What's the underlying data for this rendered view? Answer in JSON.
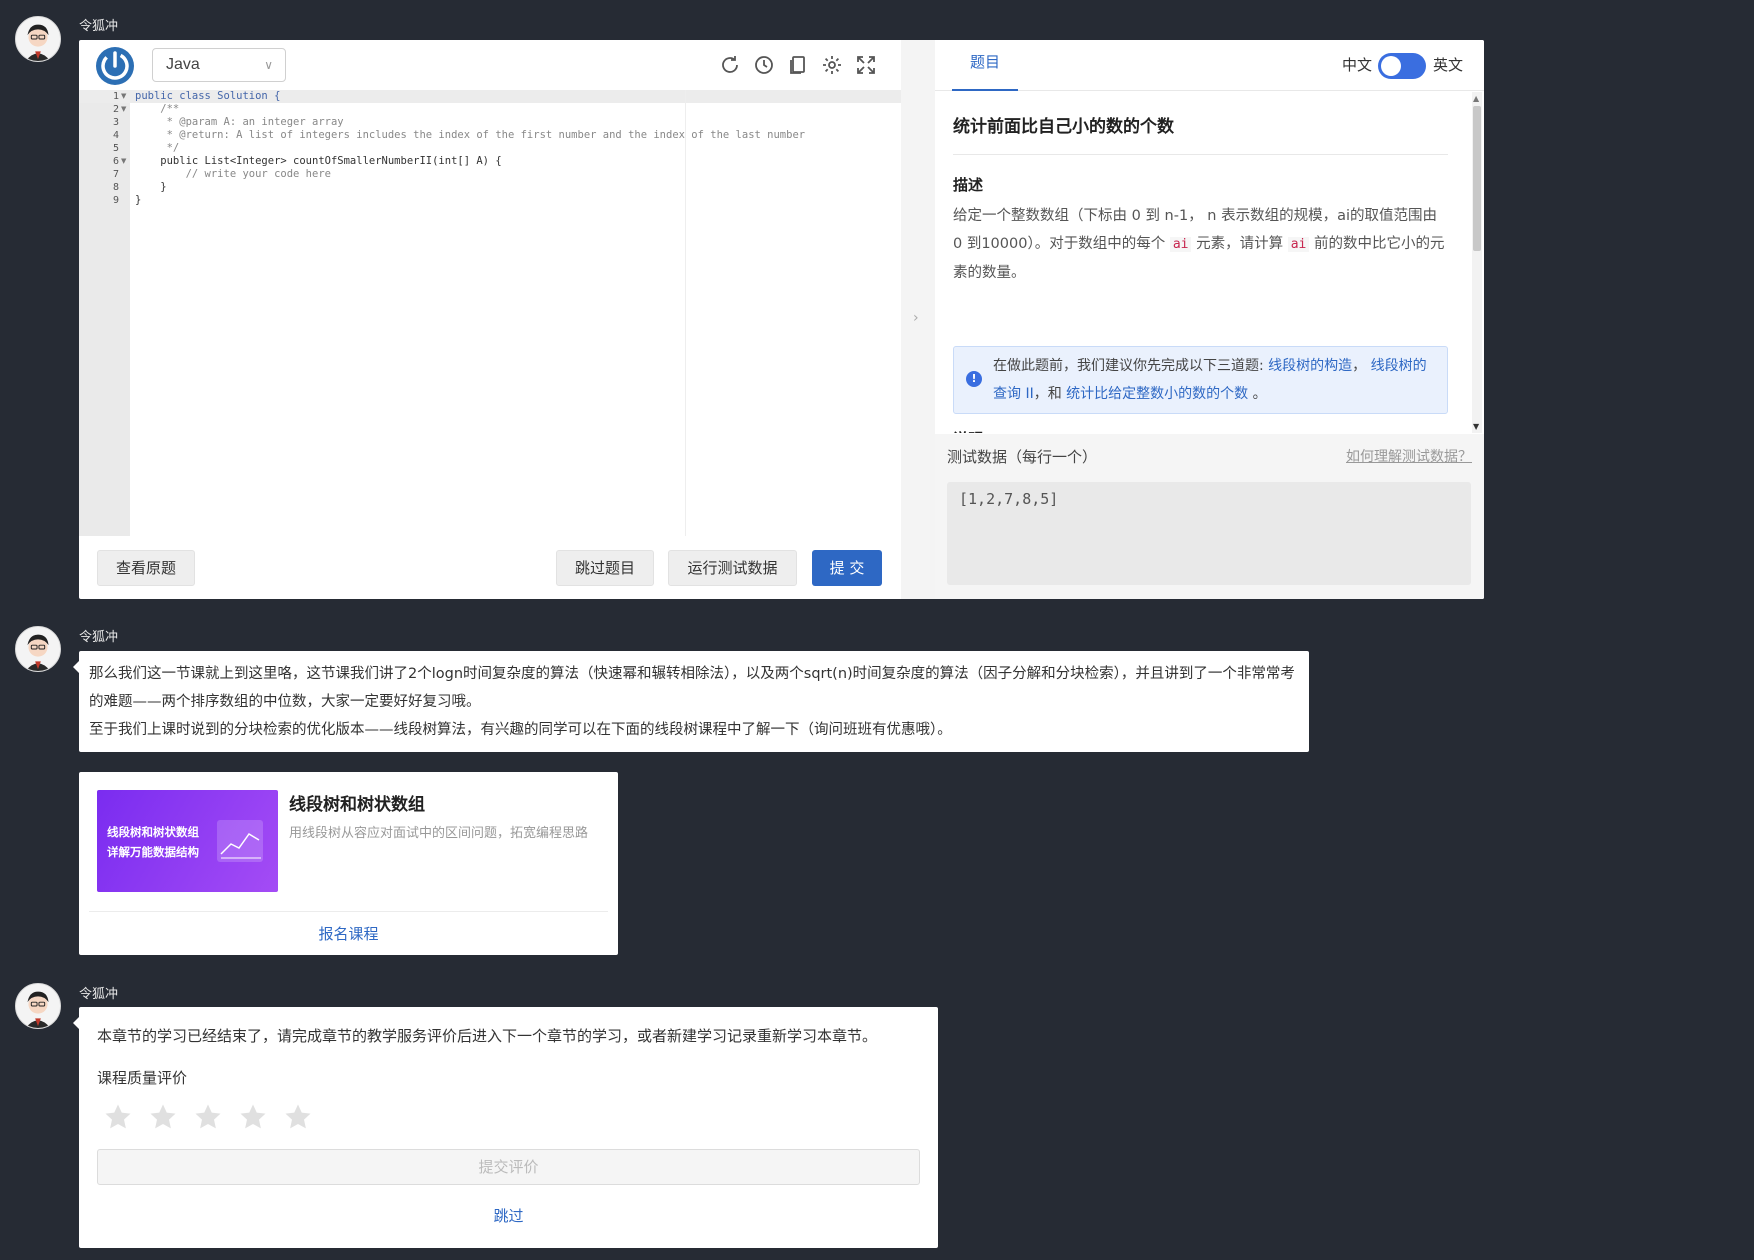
{
  "sender_name": "令狐冲",
  "ide": {
    "language": "Java",
    "code_lines": [
      "public class Solution {",
      "    /**",
      "     * @param A: an integer array",
      "     * @return: A list of integers includes the index of the first number and the index of the last number",
      "     */",
      "    public List<Integer> countOfSmallerNumberII(int[] A) {",
      "        // write your code here",
      "    }",
      "}"
    ],
    "line_numbers": [
      "1",
      "2",
      "3",
      "4",
      "5",
      "6",
      "7",
      "8",
      "9"
    ],
    "toolbar_icons": [
      "refresh-icon",
      "history-icon",
      "copy-icon",
      "settings-icon",
      "fullscreen-icon"
    ],
    "buttons": {
      "view_original": "查看原题",
      "skip_problem": "跳过题目",
      "run_test": "运行测试数据",
      "submit": "提 交"
    }
  },
  "problem": {
    "tab_label": "题目",
    "lang_zh": "中文",
    "lang_en": "英文",
    "title": "统计前面比自己小的数的个数",
    "desc_heading": "描述",
    "desc_part1": "给定一个整数数组（下标由 0 到 n-1， n 表示数组的规模，ai的取值范围由 0 到10000）。对于数组中的每个 ",
    "desc_code1": "ai",
    "desc_part2": " 元素，请计算 ",
    "desc_code2": "ai",
    "desc_part3": " 前的数中比它小的元素的数量。",
    "hint_prefix": "在做此题前，我们建议你先完成以下三道题: ",
    "hint_link1": "线段树的构造",
    "hint_sep1": "， ",
    "hint_link2": "线段树的查询 II",
    "hint_sep2": "，和 ",
    "hint_link3": "统计比给定整数小的数的个数",
    "hint_suffix": " 。",
    "explain_heading": "说明",
    "test_label": "测试数据（每行一个）",
    "test_help": "如何理解测试数据？",
    "test_value": "[1,2,7,8,5]"
  },
  "msg2": {
    "line1": "那么我们这一节课就上到这里咯，这节课我们讲了2个logn时间复杂度的算法（快速幂和辗转相除法），以及两个sqrt(n)时间复杂度的算法（因子分解和分块检索），并且讲到了一个非常常考的难题——两个排序数组的中位数，大家一定要好好复习哦。",
    "line2": "至于我们上课时说到的分块检索的优化版本——线段树算法，有兴趣的同学可以在下面的线段树课程中了解一下（询问班班有优惠哦）。"
  },
  "course": {
    "image_text_line1": "线段树和树状数组",
    "image_text_line2": "详解万能数据结构",
    "title": "线段树和树状数组",
    "description": "用线段树从容应对面试中的区间问题，拓宽编程思路",
    "enroll": "报名课程"
  },
  "msg3": {
    "text": "本章节的学习已经结束了，请完成章节的教学服务评价后进入下一个章节的学习，或者新建学习记录重新学习本章节。",
    "rating_label": "课程质量评价",
    "rating_value": 0,
    "rating_max": 5,
    "submit": "提交评价",
    "skip": "跳过"
  },
  "colors": {
    "background": "#262b34",
    "primary": "#2e68c4",
    "toggle": "#3a6ee0",
    "course_gradient_start": "#7a2cf0",
    "course_gradient_end": "#a44cf5"
  }
}
